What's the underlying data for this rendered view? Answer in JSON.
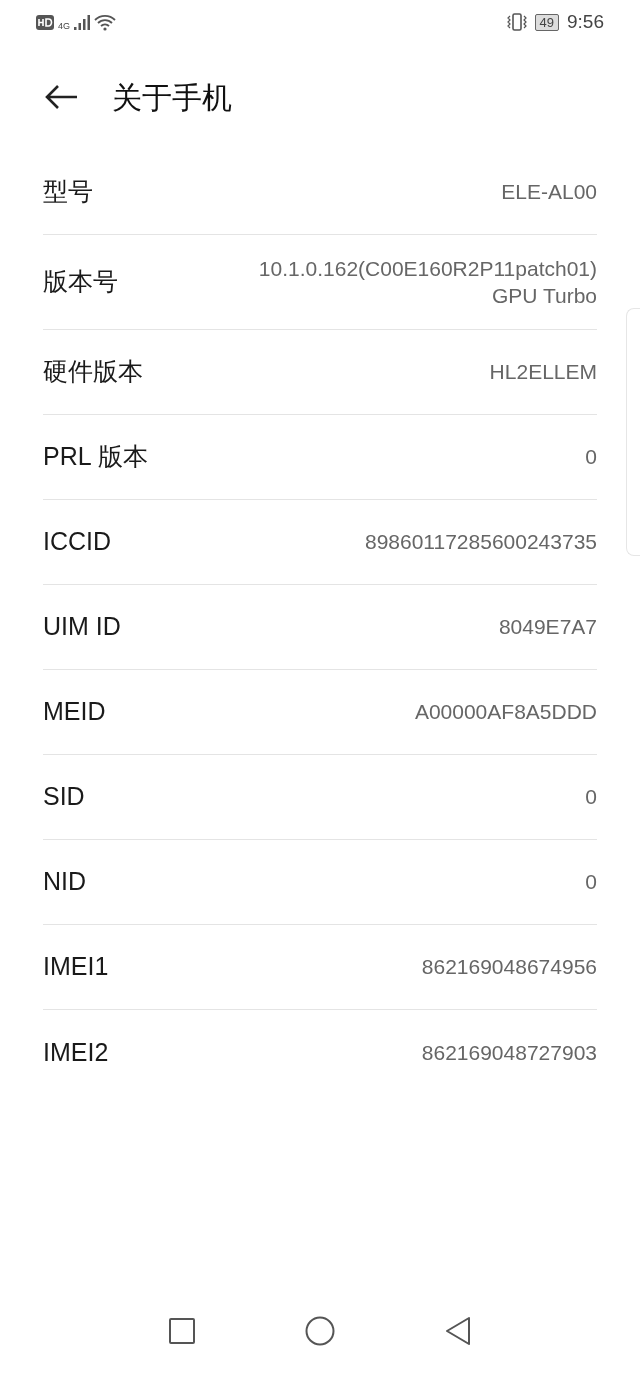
{
  "status_bar": {
    "network": "4G",
    "battery": "49",
    "time": "9:56"
  },
  "header": {
    "title": "关于手机"
  },
  "rows": [
    {
      "label": "型号",
      "value": [
        "ELE-AL00"
      ]
    },
    {
      "label": "版本号",
      "value": [
        "10.1.0.162(C00E160R2P11patch01)",
        "GPU Turbo"
      ]
    },
    {
      "label": "硬件版本",
      "value": [
        "HL2ELLEM"
      ]
    },
    {
      "label": "PRL 版本",
      "value": [
        "0"
      ]
    },
    {
      "label": "ICCID",
      "value": [
        "89860117285600243735"
      ]
    },
    {
      "label": "UIM ID",
      "value": [
        "8049E7A7"
      ]
    },
    {
      "label": "MEID",
      "value": [
        "A00000AF8A5DDD"
      ]
    },
    {
      "label": "SID",
      "value": [
        "0"
      ]
    },
    {
      "label": "NID",
      "value": [
        "0"
      ]
    },
    {
      "label": "IMEI1",
      "value": [
        "862169048674956"
      ]
    },
    {
      "label": "IMEI2",
      "value": [
        "862169048727903"
      ]
    }
  ]
}
